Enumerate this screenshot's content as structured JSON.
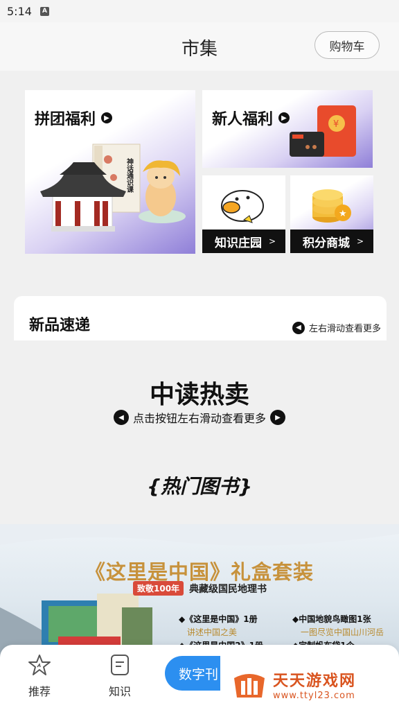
{
  "status_bar": {
    "time": "5:14",
    "app_icon": "A"
  },
  "header": {
    "title": "市集",
    "cart_label": "购物车"
  },
  "promo": {
    "group_buy": {
      "label": "拼团福利",
      "book_text": "神话通识课"
    },
    "new_user": {
      "label": "新人福利"
    },
    "knowledge_garden": {
      "label": "知识庄园"
    },
    "points_mall": {
      "label": "积分商城"
    }
  },
  "new_arrivals": {
    "title": "新品速递",
    "hint": "左右滑动查看更多"
  },
  "hot_sale": {
    "title": "中读热卖",
    "hint": "点击按钮左右滑动查看更多"
  },
  "hot_books": {
    "title": "{热门图书}"
  },
  "banner": {
    "title": "《这里是中国》礼盒套装",
    "badge": "致敬100年",
    "subtitle": "典藏级国民地理书",
    "items": [
      {
        "name": "◆《这里是中国》1册",
        "desc": "讲述中国之美"
      },
      {
        "name": "◆中国地貌鸟瞰图1张",
        "desc": "一图尽览中国山川河岳"
      },
      {
        "name": "◆《这里是中国2》1册",
        "desc": ""
      },
      {
        "name": "◆定制帆布袋1个",
        "desc": ""
      }
    ]
  },
  "tabbar": {
    "tabs": [
      {
        "label": "推荐",
        "icon": "star-icon"
      },
      {
        "label": "知识",
        "icon": "document-icon"
      }
    ],
    "digital_label": "数字刊"
  },
  "watermark": {
    "name": "天天游戏网",
    "url": "www.ttyl23.com"
  },
  "colors": {
    "accent": "#2c8ff0",
    "banner_gold": "#c7923c",
    "watermark": "#d9541f",
    "gradient_purple": "#8f7fd8"
  }
}
